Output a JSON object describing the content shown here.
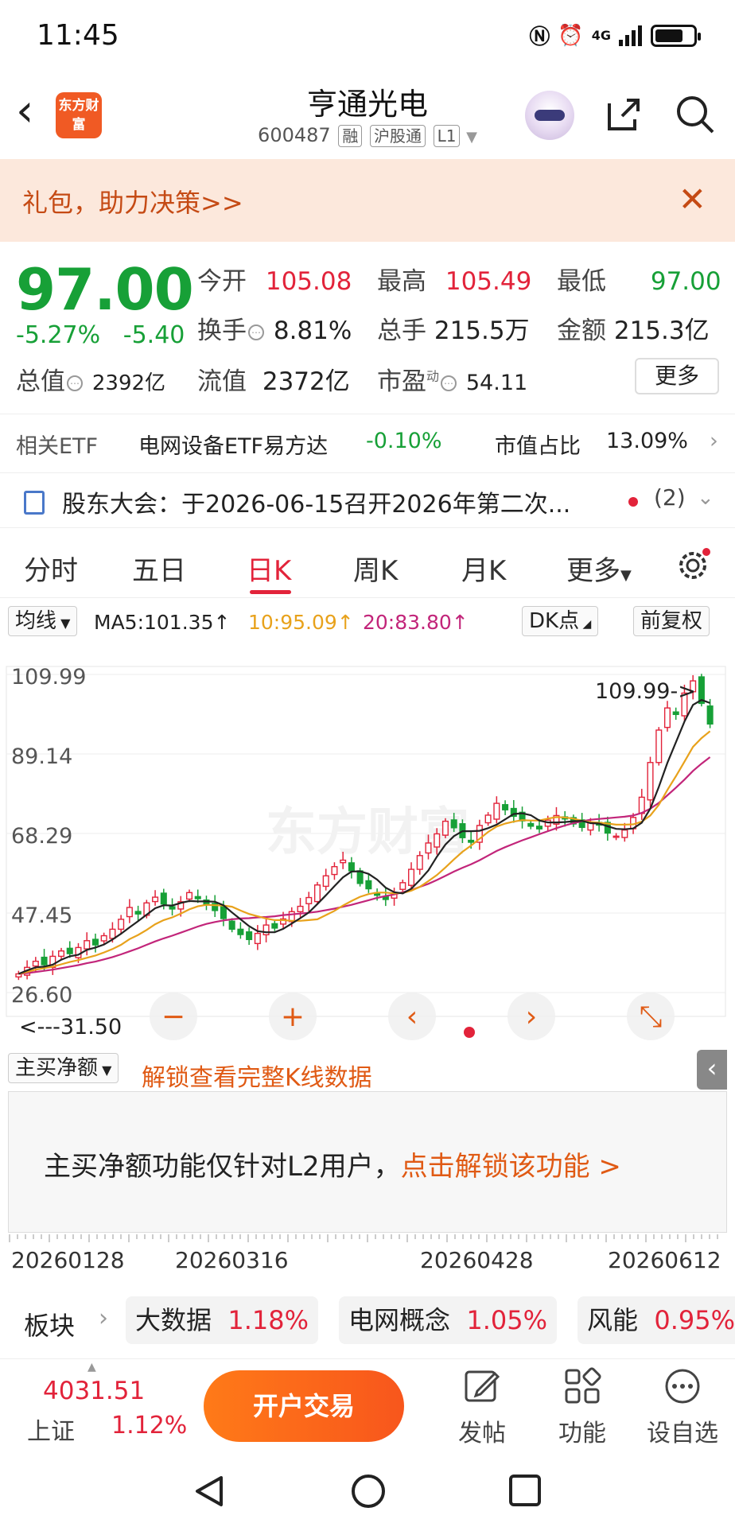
{
  "status_bar": {
    "time": "11:45",
    "network": "4G"
  },
  "header": {
    "title": "亨通光电",
    "code": "600487",
    "tags": [
      "融",
      "沪股通",
      "L1"
    ],
    "logo_text": "东方财富"
  },
  "banner": {
    "text": "礼包，助力决策>>"
  },
  "quote": {
    "price": "97.00",
    "change_pct": "-5.27%",
    "change": "-5.40",
    "stats": {
      "open_label": "今开",
      "open": "105.08",
      "high_label": "最高",
      "high": "105.49",
      "low_label": "最低",
      "low": "97.00",
      "turnover_label": "换手",
      "turnover": "8.81%",
      "volume_label": "总手",
      "volume": "215.5万",
      "amount_label": "金额",
      "amount": "215.3亿",
      "mcap_label": "总值",
      "mcap": "2392亿",
      "float_label": "流值",
      "float": "2372亿",
      "pe_label": "市盈",
      "pe_sup": "动",
      "pe": "54.11"
    },
    "more_label": "更多"
  },
  "etf": {
    "label": "相关ETF",
    "name": "电网设备ETF易方达",
    "change": "-0.10%",
    "weight_label": "市值占比",
    "weight": "13.09%"
  },
  "meeting": {
    "text": "股东大会：于2026-06-15召开2026年第二次...",
    "count": "(2)"
  },
  "tabs": [
    "分时",
    "五日",
    "日K",
    "周K",
    "月K",
    "更多"
  ],
  "active_tab": "日K",
  "ma_row": {
    "selector": "均线",
    "ma5": "MA5:101.35↑",
    "ma10": "10:95.09↑",
    "ma20": "20:83.80↑",
    "dk": "DK点",
    "adjust": "前复权"
  },
  "chart_data": {
    "type": "candlestick",
    "y_ticks": [
      "109.99",
      "89.14",
      "68.29",
      "47.45",
      "26.60"
    ],
    "ylim": [
      26.6,
      109.99
    ],
    "max_marker": "109.99->",
    "min_marker": "<---31.50",
    "watermark": "东方财富",
    "x_ticks": [
      "20260128",
      "20260316",
      "20260428",
      "20260612"
    ],
    "close": [
      31.5,
      33.2,
      34.8,
      33.9,
      36.1,
      37.5,
      36.8,
      38.4,
      40.2,
      39.1,
      41.5,
      43.2,
      45.8,
      48.9,
      47.2,
      50.1,
      51.6,
      49.8,
      48.5,
      50.4,
      52.8,
      51.2,
      49.6,
      48.1,
      46.0,
      43.2,
      41.8,
      40.5,
      42.1,
      44.3,
      43.5,
      45.9,
      47.8,
      49.2,
      51.5,
      54.8,
      57.2,
      59.6,
      61.3,
      58.5,
      55.2,
      53.8,
      52.1,
      51.0,
      52.6,
      55.4,
      58.9,
      62.5,
      65.8,
      68.2,
      71.5,
      69.8,
      67.2,
      66.0,
      70.4,
      73.1,
      76.2,
      74.5,
      72.8,
      71.6,
      70.2,
      69.5,
      71.8,
      73.0,
      72.1,
      70.8,
      69.9,
      71.2,
      70.5,
      68.4,
      67.6,
      69.2,
      72.5,
      77.8,
      86.9,
      95.4,
      101.2,
      99.5,
      105.1,
      108.3,
      102.4,
      97.0
    ],
    "ma5": [
      31.5,
      32.4,
      33.2,
      33.4,
      33.9,
      35.2,
      36.1,
      36.5,
      37.8,
      38.4,
      39.2,
      40.5,
      42.0,
      43.7,
      45.3,
      47.0,
      48.7,
      49.5,
      49.4,
      50.1,
      50.6,
      50.5,
      50.5,
      50.4,
      49.5,
      47.6,
      45.8,
      44.0,
      42.7,
      42.4,
      42.4,
      43.3,
      44.7,
      46.1,
      47.6,
      49.8,
      52.1,
      54.5,
      56.8,
      58.3,
      58.4,
      57.7,
      56.2,
      54.1,
      52.9,
      52.6,
      53.8,
      56.1,
      58.6,
      62.2,
      65.4,
      67.6,
      68.9,
      68.9,
      69.0,
      69.7,
      70.6,
      72.0,
      73.4,
      73.6,
      73.1,
      71.7,
      71.2,
      71.2,
      71.3,
      71.5,
      71.6,
      71.0,
      70.9,
      70.2,
      69.5,
      69.4,
      69.6,
      71.1,
      74.8,
      80.5,
      86.8,
      92.2,
      97.6,
      102.0,
      103.3,
      102.5
    ],
    "ma10": [
      31.5,
      32.0,
      32.6,
      33.0,
      33.4,
      34.0,
      34.6,
      35.1,
      35.7,
      36.3,
      37.1,
      38.0,
      39.1,
      40.6,
      41.7,
      43.0,
      44.5,
      45.6,
      46.3,
      47.3,
      48.4,
      49.2,
      49.6,
      49.5,
      49.4,
      49.1,
      48.1,
      47.2,
      46.6,
      46.0,
      45.6,
      45.6,
      45.4,
      45.4,
      45.6,
      45.8,
      46.9,
      48.0,
      49.4,
      50.6,
      51.7,
      52.4,
      52.8,
      52.8,
      52.6,
      52.7,
      53.3,
      54.3,
      55.8,
      57.4,
      59.4,
      61.5,
      63.5,
      65.1,
      66.9,
      68.7,
      70.1,
      70.9,
      71.4,
      71.8,
      71.7,
      71.7,
      72.2,
      72.6,
      72.5,
      72.2,
      71.6,
      71.3,
      71.1,
      70.9,
      70.6,
      70.6,
      70.7,
      71.4,
      73.0,
      75.8,
      79.7,
      83.3,
      87.1,
      91.0,
      93.3,
      95.1
    ],
    "ma20": [
      31.5,
      31.7,
      32.0,
      32.3,
      32.6,
      33.0,
      33.4,
      33.8,
      34.3,
      34.7,
      35.3,
      35.9,
      36.6,
      37.4,
      38.2,
      39.1,
      40.0,
      40.8,
      41.5,
      42.3,
      43.1,
      43.9,
      44.6,
      45.1,
      45.5,
      45.8,
      46.0,
      46.1,
      46.3,
      46.4,
      46.6,
      46.9,
      47.1,
      47.3,
      47.5,
      47.8,
      48.2,
      48.6,
      49.1,
      49.6,
      50.2,
      50.8,
      51.4,
      51.9,
      52.3,
      52.9,
      53.5,
      54.3,
      55.1,
      56.1,
      57.2,
      58.3,
      59.3,
      60.2,
      61.3,
      62.5,
      63.7,
      64.7,
      65.6,
      66.5,
      67.3,
      68.1,
      68.9,
      69.7,
      70.4,
      71.0,
      71.5,
      71.9,
      72.1,
      72.3,
      72.5,
      72.7,
      73.0,
      73.7,
      74.8,
      76.3,
      78.3,
      80.3,
      82.4,
      84.7,
      86.6,
      88.3
    ]
  },
  "flow": {
    "selector": "主买净额",
    "unlock_link": "解锁查看完整K线数据",
    "message": "主买净额功能仅针对L2用户，",
    "message_link": "点击解锁该功能 >"
  },
  "sectors": {
    "label": "板块",
    "items": [
      {
        "name": "大数据",
        "pct": "1.18%"
      },
      {
        "name": "电网概念",
        "pct": "1.05%"
      },
      {
        "name": "风能",
        "pct": "0.95%"
      }
    ]
  },
  "bottom": {
    "index_value": "4031.51",
    "index_name": "上证",
    "index_pct": "1.12%",
    "trade_label": "开户交易",
    "post_label": "发帖",
    "func_label": "功能",
    "watch_label": "设自选"
  }
}
